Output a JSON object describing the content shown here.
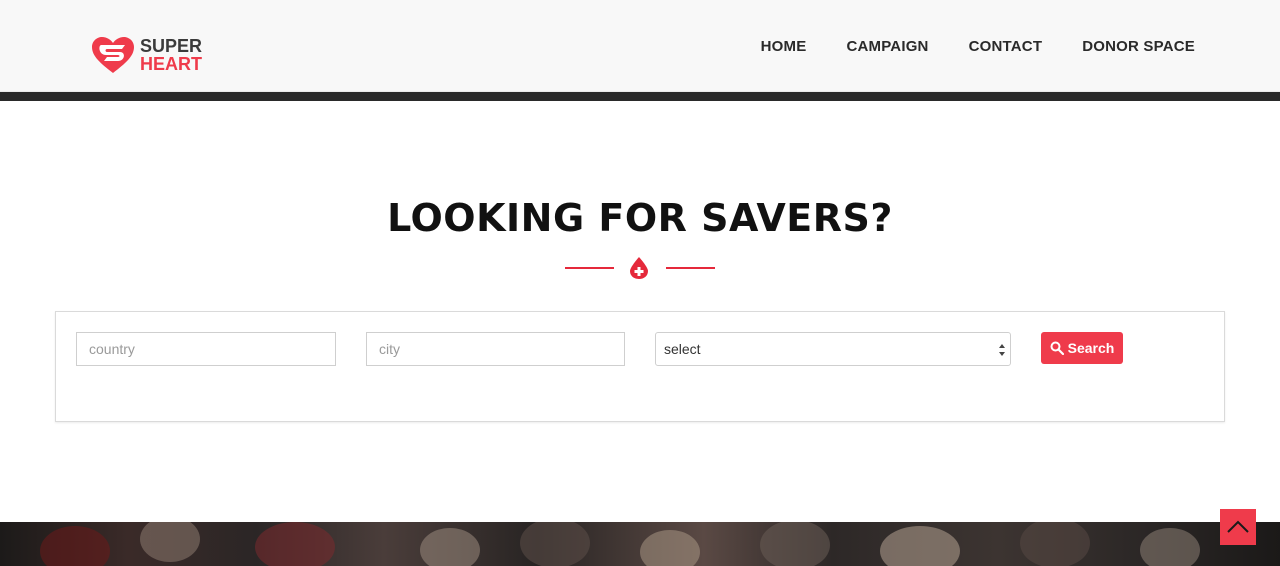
{
  "brand": {
    "line1": "SUPER",
    "line2": "HEART"
  },
  "nav": {
    "items": [
      "HOME",
      "CAMPAIGN",
      "CONTACT",
      "DONOR SPACE"
    ]
  },
  "hero": {
    "title": "LOOKING FOR SAVERS?"
  },
  "search": {
    "country_placeholder": "country",
    "city_placeholder": "city",
    "select_value": "select",
    "button_label": "Search"
  },
  "colors": {
    "accent": "#ef3b4b",
    "header_bg": "#f8f8f8",
    "dark_bar": "#2a2a2a",
    "text_dark": "#111111"
  },
  "icons": {
    "logo": "superheart-logo-icon",
    "divider": "blood-drop-plus-icon",
    "search": "search-icon",
    "back_to_top": "chevron-up-icon"
  }
}
